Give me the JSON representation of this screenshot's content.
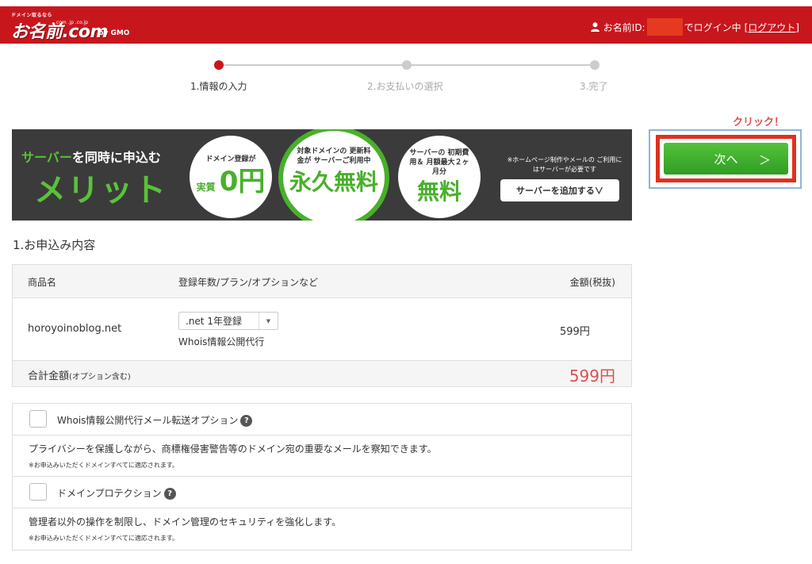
{
  "header": {
    "logo_tagline": "ドメイン取るなら",
    "logo_text": "お名前.com",
    "logo_tlds": ".com .jp .co.jp",
    "logo_by": "by GMO",
    "user_prefix": "お名前ID:",
    "user_suffix": "でログイン中",
    "logout": "[ログアウト]"
  },
  "steps": [
    {
      "label": "1.情報の入力",
      "active": true
    },
    {
      "label": "2.お支払いの選択",
      "active": false
    },
    {
      "label": "3.完了",
      "active": false
    }
  ],
  "annotation": {
    "click": "クリック！"
  },
  "next_button": {
    "label": "次へ",
    "chevron": "＞"
  },
  "banner": {
    "line1_green": "サーバー",
    "line1_rest": "を同時に申込む",
    "line2": "メリット",
    "circle1_top": "ドメイン登録が",
    "circle1_side": "実質",
    "circle1_big": "0円",
    "circle2_top": "対象ドメインの 更新料金が サーバーご利用中",
    "circle2_big": "永久無料",
    "circle3_top": "サーバーの 初期費用＆ 月額最大２ヶ月分",
    "circle3_big": "無料",
    "note": "※ホームページ制作やメールの ご利用にはサーバーが必要です",
    "button": "サーバーを追加する∨"
  },
  "section_title": "1.お申込み内容",
  "order": {
    "headers": [
      "商品名",
      "登録年数/プラン/オプションなど",
      "金額(税抜)"
    ],
    "row": {
      "name": "horoyoinoblog.net",
      "plan_select": ".net 1年登録",
      "option": "Whois情報公開代行",
      "price": "599円"
    },
    "total_label": "合計金額",
    "total_sub": "(オプション含む)",
    "total_price": "599円"
  },
  "options": [
    {
      "title": "Whois情報公開代行メール転送オプション",
      "desc": "プライバシーを保護しながら、商標権侵害警告等のドメイン宛の重要なメールを察知できます。",
      "note": "※お申込みいただくドメインすべてに適応されます。"
    },
    {
      "title": "ドメインプロテクション",
      "desc": "管理者以外の操作を制限し、ドメイン管理のセキュリティを強化します。",
      "note": "※お申込みいただくドメインすべてに適応されます。"
    }
  ],
  "colors": {
    "brand_red": "#c8161d",
    "accent_green": "#48b02a",
    "price_red": "#d9534f"
  }
}
